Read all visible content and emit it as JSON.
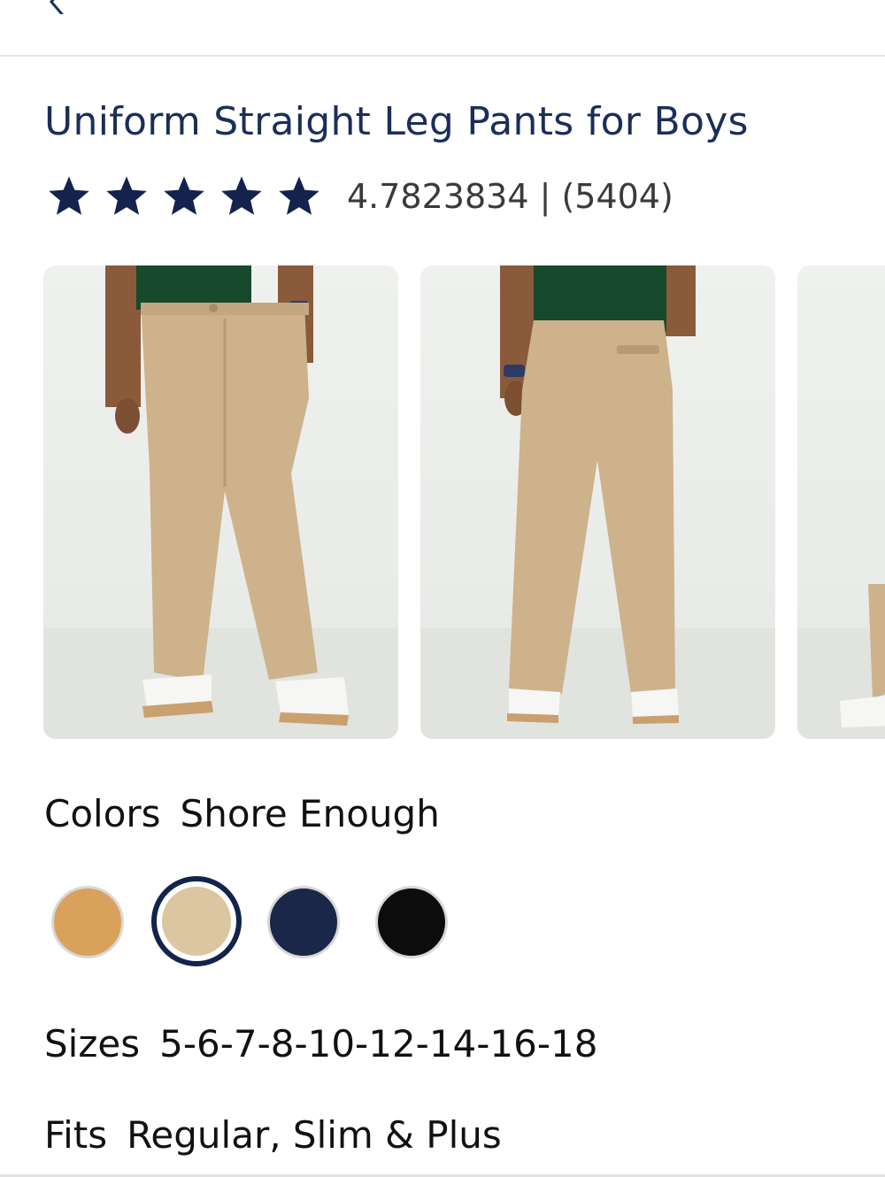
{
  "header": {
    "back_icon": "chevron-left-icon"
  },
  "product": {
    "title": "Uniform Straight Leg Pants for Boys",
    "rating_value": 4.7823834,
    "rating_text": "4.7823834 | (5404)",
    "stars": 5
  },
  "gallery": {
    "images": [
      {
        "alt": "front view"
      },
      {
        "alt": "back view"
      },
      {
        "alt": "side view"
      }
    ]
  },
  "colors": {
    "label": "Colors",
    "selected": "Shore Enough",
    "swatches": [
      {
        "color": "#d9a15a",
        "selected": false
      },
      {
        "color": "#dcc6a1",
        "selected": true
      },
      {
        "color": "#1b2748",
        "selected": false
      },
      {
        "color": "#0c0c0c",
        "selected": false
      }
    ],
    "selected_ring_color": "#13234d"
  },
  "sizes": {
    "label": "Sizes",
    "value": "5-6-7-8-10-12-14-16-18"
  },
  "fits": {
    "label": "Fits",
    "value": "Regular, Slim & Plus"
  },
  "theme": {
    "title_color": "#1a2e5a",
    "star_color": "#13234d"
  }
}
